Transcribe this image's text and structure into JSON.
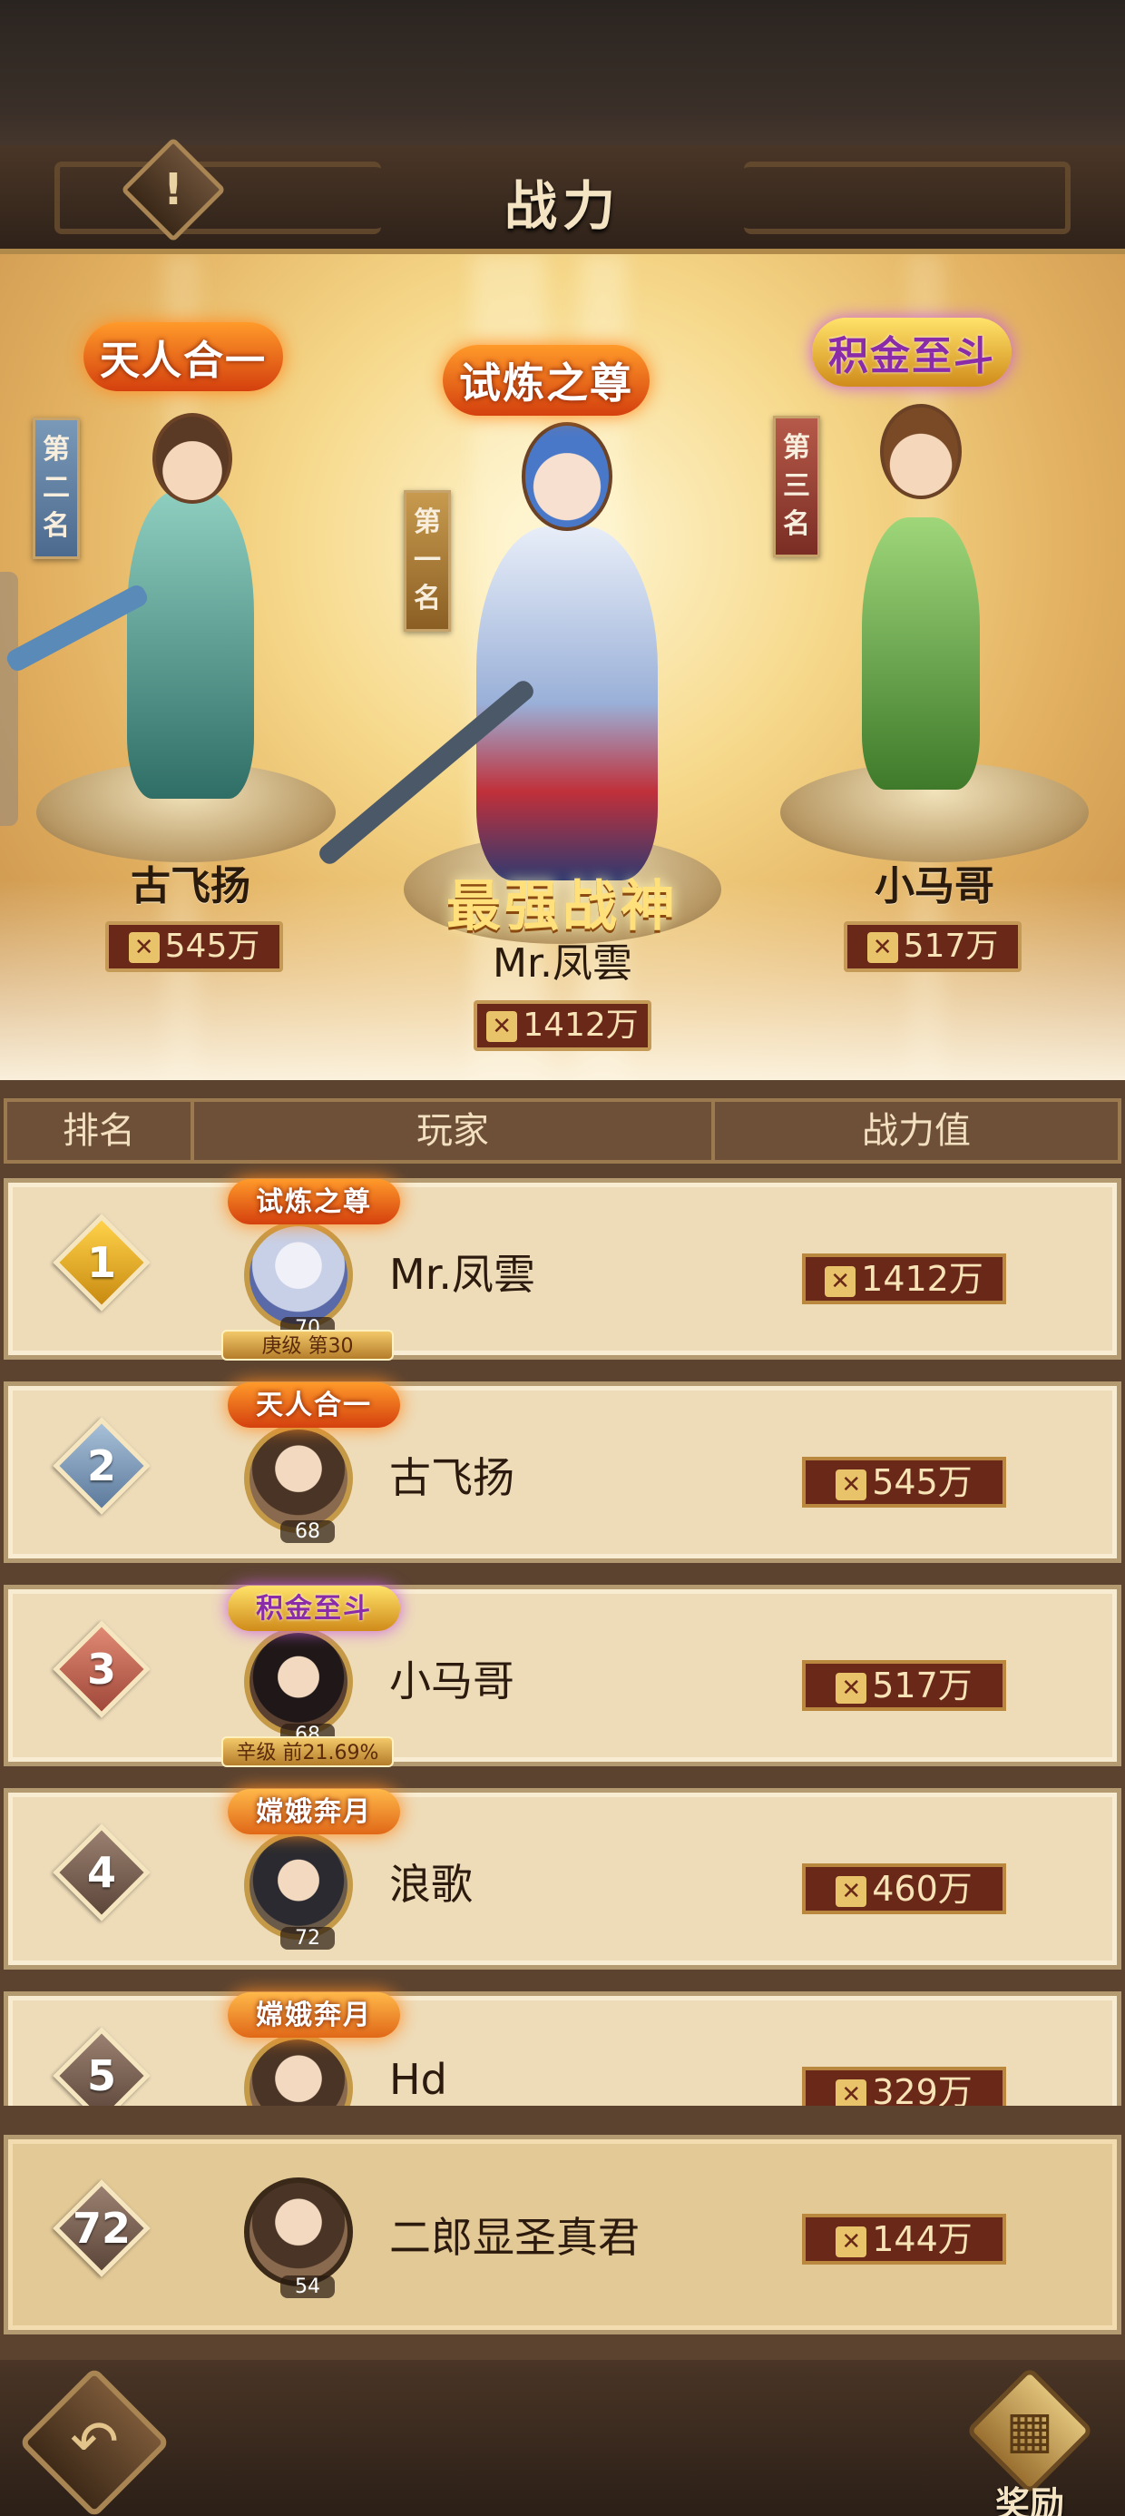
{
  "header": {
    "title": "战力",
    "info_icon": "!"
  },
  "podium": {
    "strongest_title": "最强战神",
    "first": {
      "rank_label": "第一名",
      "badge": "试炼之尊",
      "name": "Mr.凤雲",
      "power": "1412万"
    },
    "second": {
      "rank_label": "第二名",
      "badge": "天人合一",
      "name": "古飞扬",
      "power": "545万"
    },
    "third": {
      "rank_label": "第三名",
      "badge": "积金至斗",
      "name": "小马哥",
      "power": "517万"
    }
  },
  "table": {
    "columns": [
      "排名",
      "玩家",
      "战力值"
    ],
    "rows": [
      {
        "rank": "1",
        "name": "Mr.凤雲",
        "power": "1412万",
        "badge": "试炼之尊",
        "level": "70",
        "sub": "庚级 第30"
      },
      {
        "rank": "2",
        "name": "古飞扬",
        "power": "545万",
        "badge": "天人合一",
        "level": "68",
        "sub": ""
      },
      {
        "rank": "3",
        "name": "小马哥",
        "power": "517万",
        "badge": "积金至斗",
        "level": "68",
        "sub": "辛级 前21.69%"
      },
      {
        "rank": "4",
        "name": "浪歌",
        "power": "460万",
        "badge": "嫦娥奔月",
        "level": "72",
        "sub": ""
      },
      {
        "rank": "5",
        "name": "Hd",
        "power": "329万",
        "badge": "嫦娥奔月",
        "level": "",
        "sub": ""
      }
    ]
  },
  "my_rank": {
    "rank": "72",
    "name": "二郎显圣真君",
    "power": "144万",
    "level": "54"
  },
  "power_icon": "sword-shield-icon",
  "footer": {
    "back_icon": "↶",
    "reward_label": "奖励"
  },
  "colors": {
    "accent_gold": "#c59a57",
    "plate_red": "#6a2818",
    "row_bg": "#eedcb9"
  }
}
